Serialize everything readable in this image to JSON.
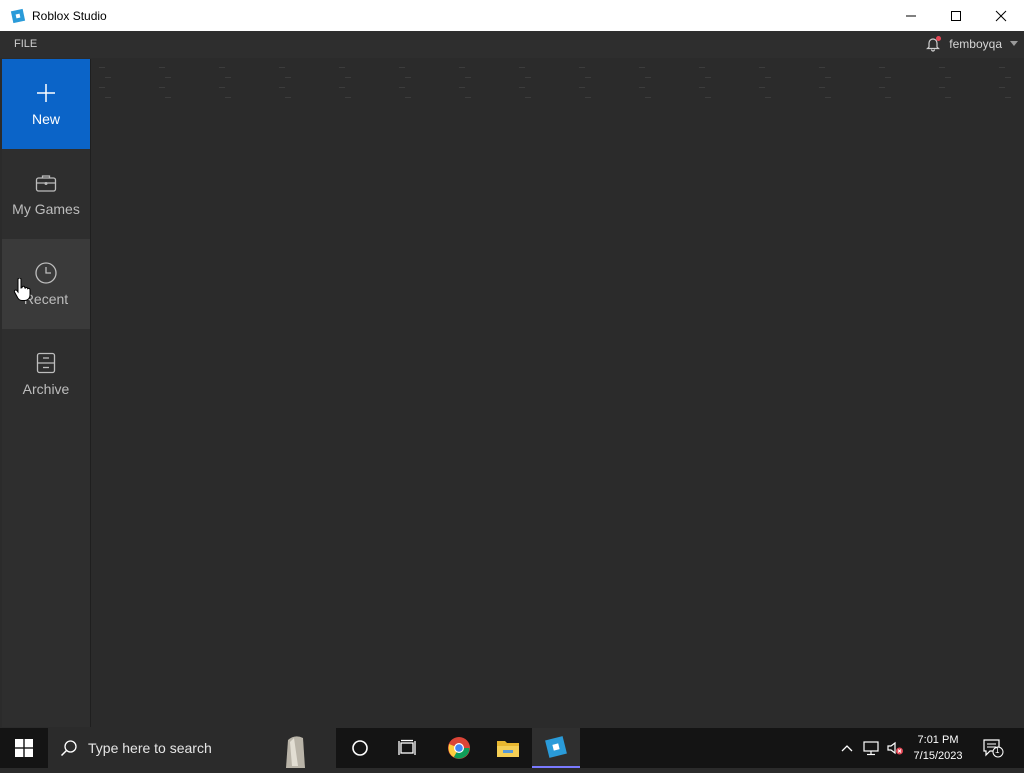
{
  "window": {
    "title": "Roblox Studio"
  },
  "menubar": {
    "file_label": "FILE",
    "username": "femboyqa"
  },
  "sidebar": {
    "items": [
      {
        "label": "New",
        "icon": "plus-icon"
      },
      {
        "label": "My Games",
        "icon": "briefcase-icon"
      },
      {
        "label": "Recent",
        "icon": "clock-icon"
      },
      {
        "label": "Archive",
        "icon": "archive-icon"
      }
    ]
  },
  "taskbar": {
    "search_placeholder": "Type here to search",
    "time": "7:01 PM",
    "date": "7/15/2023",
    "notification_count": "1"
  },
  "colors": {
    "accent": "#0b64c8",
    "background": "#2b2b2b",
    "taskbar": "#141414"
  }
}
